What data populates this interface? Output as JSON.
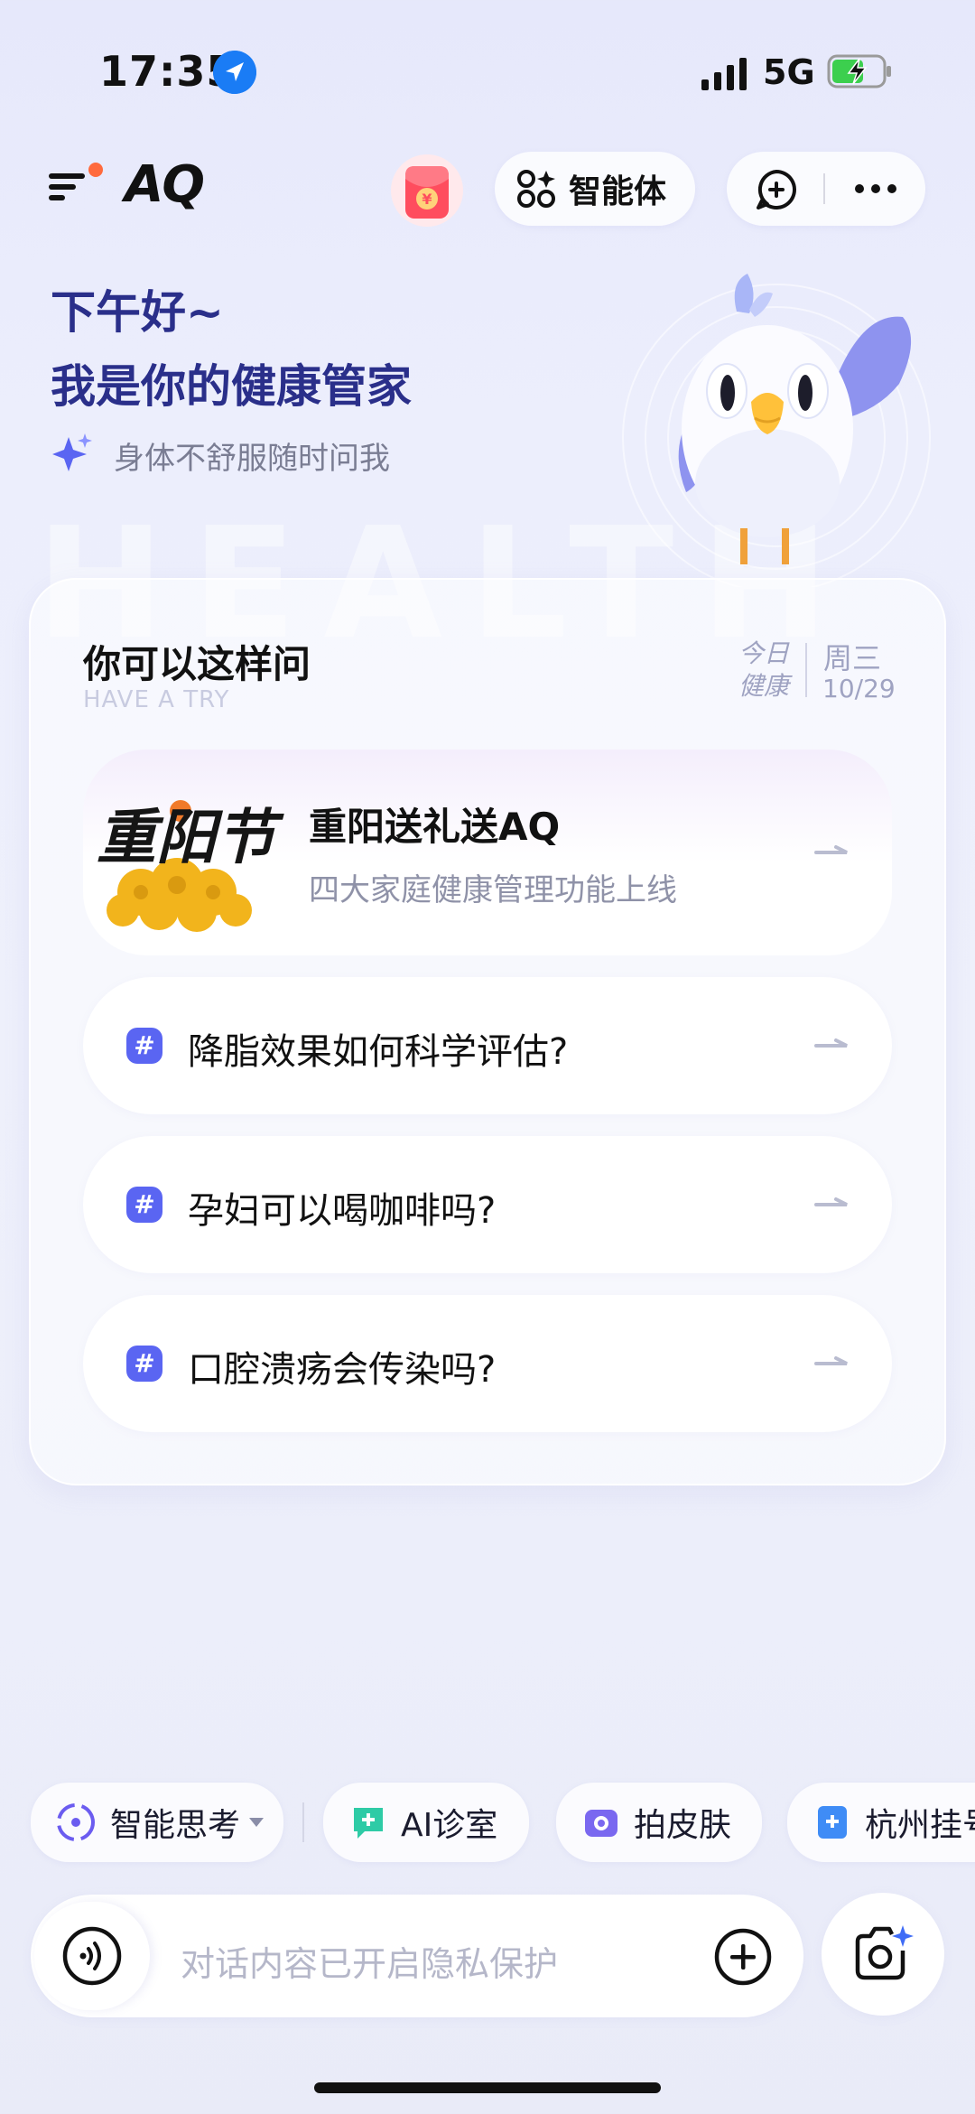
{
  "status_bar": {
    "time": "17:35",
    "network": "5G"
  },
  "header": {
    "logo": "AQ",
    "agent_label": "智能体"
  },
  "greeting": {
    "line1": "下午好~",
    "line2": "我是你的健康管家",
    "hint": "身体不舒服随时问我",
    "watermark": "HEALTH"
  },
  "card": {
    "title": "你可以这样问",
    "subtitle": "HAVE A TRY",
    "today_line1": "今日",
    "today_line2": "健康",
    "weekday": "周三",
    "date": "10/29",
    "promo": {
      "image_text": "重阳节",
      "title": "重阳送礼送AQ",
      "description": "四大家庭健康管理功能上线"
    },
    "questions": [
      {
        "text": "降脂效果如何科学评估?"
      },
      {
        "text": "孕妇可以喝咖啡吗?"
      },
      {
        "text": "口腔溃疡会传染吗?"
      }
    ]
  },
  "shortcuts": [
    {
      "label": "智能思考"
    },
    {
      "label": "AI诊室",
      "color": "#2ecba6"
    },
    {
      "label": "拍皮肤",
      "color": "#7a68f0"
    },
    {
      "label": "杭州挂号",
      "color": "#3f8cf6"
    }
  ],
  "input": {
    "placeholder": "对话内容已开启隐私保护"
  },
  "colors": {
    "accent": "#5a65f2",
    "heading": "#2a2f8a",
    "notification_dot": "#ff6a3d"
  }
}
